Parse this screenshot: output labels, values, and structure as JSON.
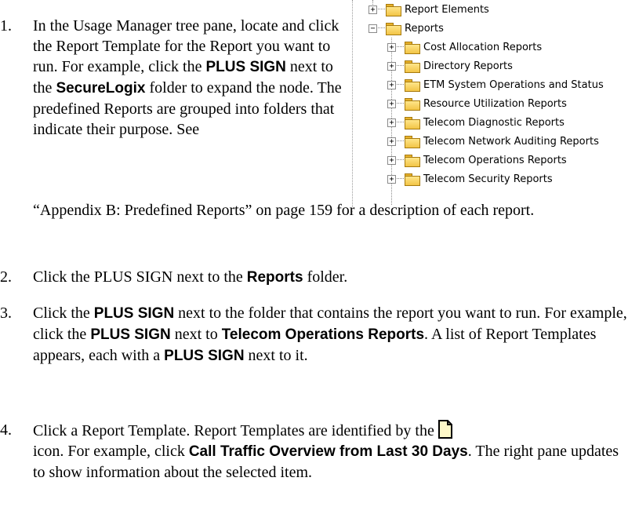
{
  "tree": {
    "nodes": [
      {
        "label": "Report Elements",
        "expander": "+"
      },
      {
        "label": "Reports",
        "expander": "−"
      },
      {
        "label": "Cost Allocation Reports",
        "expander": "+"
      },
      {
        "label": "Directory Reports",
        "expander": "+"
      },
      {
        "label": "ETM System Operations and Status",
        "expander": "+"
      },
      {
        "label": "Resource Utilization Reports",
        "expander": "+"
      },
      {
        "label": "Telecom Diagnostic Reports",
        "expander": "+"
      },
      {
        "label": "Telecom Network Auditing Reports",
        "expander": "+"
      },
      {
        "label": "Telecom Operations Reports",
        "expander": "+"
      },
      {
        "label": "Telecom Security Reports",
        "expander": "+"
      }
    ]
  },
  "steps": [
    {
      "number": "1.",
      "p1": "In the Usage Manager tree pane, locate and click the Report Template for the Report you want to run. For example, click the ",
      "b1": "PLUS SIGN",
      "p2": " next to the ",
      "b2": "SecureLogix",
      "p3": " folder to expand the node. The predefined Reports are grouped into folders that indicate their purpose. See",
      "p4": "“Appendix B: Predefined Reports” on page 159 for a description of each report."
    },
    {
      "number": "2.",
      "p1": "Click the PLUS SIGN next to the ",
      "b1": "Reports",
      "p2": " folder."
    },
    {
      "number": "3.",
      "p1": "Click the ",
      "b1": "PLUS SIGN",
      "p2": " next to the folder that contains the report you want to run. For example, click the ",
      "b2": "PLUS SIGN",
      "p3": " next to ",
      "b3": "Telecom Operations Reports",
      "p4": ". A list of Report Templates appears, each with a ",
      "b4": "PLUS SIGN",
      "p5": " next to it."
    },
    {
      "number": "4.",
      "p1": "Click a Report Template. Report Templates are identified by the",
      "p2": "icon. For example, click ",
      "b1": "Call Traffic Overview from Last 30 Days",
      "p3": ". The right pane updates to show information about the selected item.",
      "icon": "report-template-icon"
    }
  ]
}
